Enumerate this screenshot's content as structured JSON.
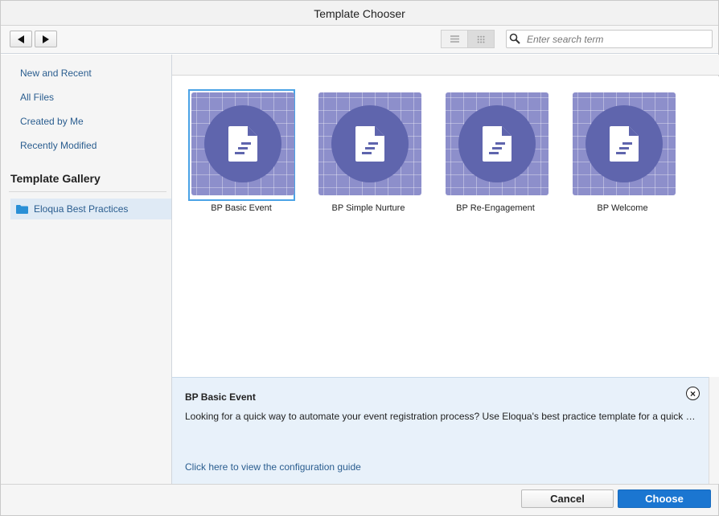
{
  "window": {
    "title": "Template Chooser"
  },
  "toolbar": {
    "back_icon": "arrow-left-icon",
    "forward_icon": "arrow-right-icon",
    "list_view_icon": "list-view-icon",
    "grid_view_icon": "grid-view-icon",
    "active_view": "grid",
    "search_placeholder": "Enter search term",
    "search_value": ""
  },
  "sidebar": {
    "links": [
      {
        "label": "New and Recent"
      },
      {
        "label": "All Files"
      },
      {
        "label": "Created by Me"
      },
      {
        "label": "Recently Modified"
      }
    ],
    "gallery_title": "Template Gallery",
    "gallery_items": [
      {
        "label": "Eloqua Best Practices",
        "icon": "folder-icon",
        "selected": true
      }
    ]
  },
  "templates": [
    {
      "label": "BP Basic Event",
      "selected": true
    },
    {
      "label": "BP Simple Nurture",
      "selected": false
    },
    {
      "label": "BP Re-Engagement",
      "selected": false
    },
    {
      "label": "BP Welcome",
      "selected": false
    }
  ],
  "details": {
    "title": "BP Basic Event",
    "description": "Looking for a quick way to automate your event registration process? Use Eloqua's best practice template for a quick …",
    "link": "Click here to view the configuration guide"
  },
  "footer": {
    "cancel_label": "Cancel",
    "choose_label": "Choose"
  },
  "colors": {
    "accent": "#1b76d1",
    "selection_border": "#4ba3e6",
    "thumb_bg": "#8d8fcb",
    "thumb_circle": "#5f65ad",
    "link": "#2a5d8f"
  }
}
